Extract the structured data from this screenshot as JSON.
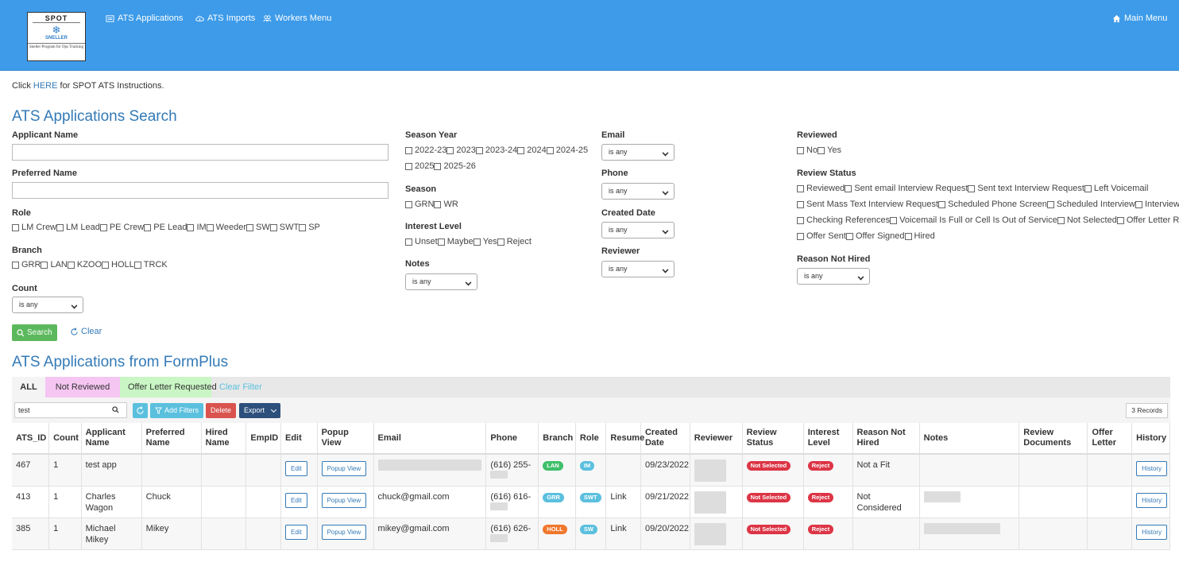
{
  "header": {
    "logo_text": "SPOT",
    "logo_brand": "SNELLER",
    "logo_tagline": "Sneller Program for Ops Tracking",
    "nav": [
      {
        "icon": "list-icon",
        "label": "ATS Applications"
      },
      {
        "icon": "cloud-upload-icon",
        "label": "ATS Imports"
      },
      {
        "icon": "users-icon",
        "label": "Workers Menu"
      }
    ],
    "main_menu": {
      "icon": "home-icon",
      "label": "Main Menu"
    }
  },
  "instructions": {
    "prefix": "Click ",
    "link": "HERE",
    "suffix": " for SPOT ATS Instructions."
  },
  "search": {
    "title": "ATS Applications Search",
    "applicant_name_label": "Applicant Name",
    "preferred_name_label": "Preferred Name",
    "role_label": "Role",
    "role_options": [
      "LM Crew",
      "LM Lead",
      "PE Crew",
      "PE Lead",
      "IM",
      "Weeder",
      "SW",
      "SWT",
      "SP"
    ],
    "branch_label": "Branch",
    "branch_options": [
      "GRR",
      "LAN",
      "KZOO",
      "HOLL",
      "TRCK"
    ],
    "count_label": "Count",
    "count_value": "is any",
    "season_year_label": "Season Year",
    "season_year_options_row1": [
      "2022-23",
      "2023",
      "2023-24",
      "2024",
      "2024-25"
    ],
    "season_year_options_row2": [
      "2025",
      "2025-26"
    ],
    "season_label": "Season",
    "season_options": [
      "GRN",
      "WR"
    ],
    "interest_level_label": "Interest Level",
    "interest_level_options": [
      "Unset",
      "Maybe",
      "Yes",
      "Reject"
    ],
    "notes_label": "Notes",
    "notes_value": "is any",
    "email_label": "Email",
    "email_value": "is any",
    "phone_label": "Phone",
    "phone_value": "is any",
    "created_date_label": "Created Date",
    "created_date_value": "is any",
    "reviewer_label": "Reviewer",
    "reviewer_value": "is any",
    "reviewed_label": "Reviewed",
    "reviewed_options": [
      "No",
      "Yes"
    ],
    "review_status_label": "Review Status",
    "review_status_row1": [
      "Reviewed",
      "Sent email Interview Request",
      "Sent text Interview Request",
      "Left Voicemail"
    ],
    "review_status_row2": [
      "Sent Mass Text Interview Request",
      "Scheduled Phone Screen",
      "Scheduled Interview",
      "Interviewed"
    ],
    "review_status_row3": [
      "Checking References",
      "Voicemail Is Full or Cell Is Out of Service",
      "Not Selected",
      "Offer Letter Requested"
    ],
    "review_status_row4": [
      "Offer Sent",
      "Offer Signed",
      "Hired"
    ],
    "reason_not_hired_label": "Reason Not Hired",
    "reason_not_hired_value": "is any",
    "search_button": "Search",
    "clear_button": "Clear"
  },
  "results": {
    "title": "ATS Applications from FormPlus",
    "tabs": [
      "ALL",
      "Not Reviewed",
      "Offer Letter Requested",
      "Clear Filter"
    ],
    "filter_value": "test",
    "add_filters": "Add Filters",
    "delete": "Delete",
    "export": "Export",
    "record_count": "3 Records",
    "columns": [
      "ATS_ID",
      "Count",
      "Applicant Name",
      "Preferred Name",
      "Hired Name",
      "EmpID",
      "Edit",
      "Popup View",
      "Email",
      "Phone",
      "Branch",
      "Role",
      "Resume",
      "Created Date",
      "Reviewer",
      "Review Status",
      "Interest Level",
      "Reason Not Hired",
      "Notes",
      "Review Documents",
      "Offer Letter",
      "History"
    ],
    "rows": [
      {
        "ats_id": "467",
        "count": "1",
        "applicant": "test app",
        "preferred": "",
        "email": "",
        "phone": "(616) 255-",
        "branch": "LAN",
        "role": "IM",
        "resume": "",
        "created": "09/23/2022",
        "reviewer": "",
        "review_status": "Not Selected",
        "interest": "Reject",
        "reason": "Not a Fit"
      },
      {
        "ats_id": "413",
        "count": "1",
        "applicant": "Charles Wagon",
        "preferred": "Chuck",
        "email": "chuck@gmail.com",
        "phone": "(616) 616-",
        "branch": "GRR",
        "role": "SWT",
        "resume": "Link",
        "created": "09/21/2022",
        "reviewer": "",
        "review_status": "Not Selected",
        "interest": "Reject",
        "reason": "Not Considered"
      },
      {
        "ats_id": "385",
        "count": "1",
        "applicant": "Michael Mikey",
        "preferred": "Mikey",
        "email": "mikey@gmail.com",
        "phone": "(616) 626-",
        "branch": "HOLL",
        "role": "SW",
        "resume": "Link",
        "created": "09/20/2022",
        "reviewer": "",
        "review_status": "Not Selected",
        "interest": "Reject",
        "reason": ""
      }
    ],
    "edit_label": "Edit",
    "popup_label": "Popup View",
    "history_label": "History"
  },
  "colors": {
    "header": "#3d9be9",
    "link": "#337ab7",
    "success": "#5cb85c",
    "danger": "#d9534f",
    "pill_red": "#dc3545",
    "branch_lan": "#3fbf6a",
    "branch_grr": "#5bc0de",
    "branch_holl": "#f0772c"
  }
}
